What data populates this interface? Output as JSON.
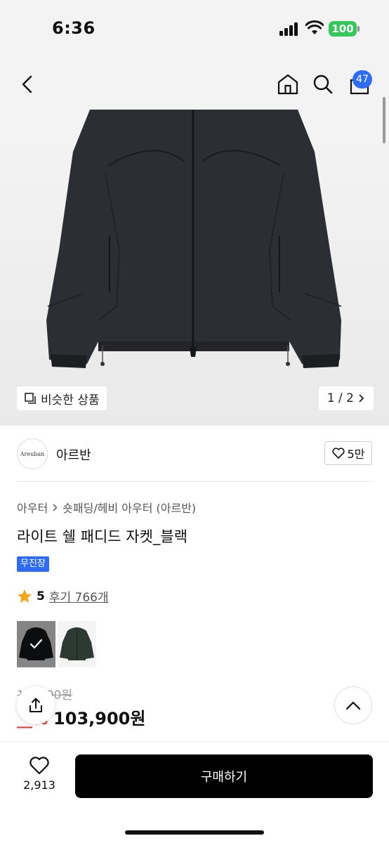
{
  "status_bar": {
    "time": "6:36",
    "battery": "100",
    "icons": [
      "signal-icon",
      "wifi-icon",
      "battery-icon"
    ]
  },
  "nav": {
    "icons": [
      "back-icon",
      "home-icon",
      "search-icon",
      "cart-icon"
    ],
    "cart_count": "47"
  },
  "gallery": {
    "similar_label": "비슷한 상품",
    "page_indicator": "1 / 2"
  },
  "brand": {
    "logo_text": "Areuban",
    "name": "아르반",
    "likes": "5만"
  },
  "breadcrumb": {
    "items": [
      "아우터",
      "숏패딩/헤비 아우터 (아르반)"
    ]
  },
  "product": {
    "title": "라이트 쉘 패디드 자켓_블랙",
    "tag": "무진장",
    "rating": "5",
    "reviews": "후기 766개",
    "original_price": "1__,_00원",
    "discount": "__%",
    "price": "103,900원"
  },
  "color_options": [
    {
      "name": "black",
      "selected": true
    },
    {
      "name": "dark-green",
      "selected": false
    }
  ],
  "bottom_bar": {
    "wish_count": "2,913",
    "buy_label": "구매하기"
  },
  "colors": {
    "accent": "#2f6cf5",
    "battery": "#34c759",
    "discount": "#e53935",
    "buy_button": "#000000",
    "jacket": "#2a2d30"
  }
}
